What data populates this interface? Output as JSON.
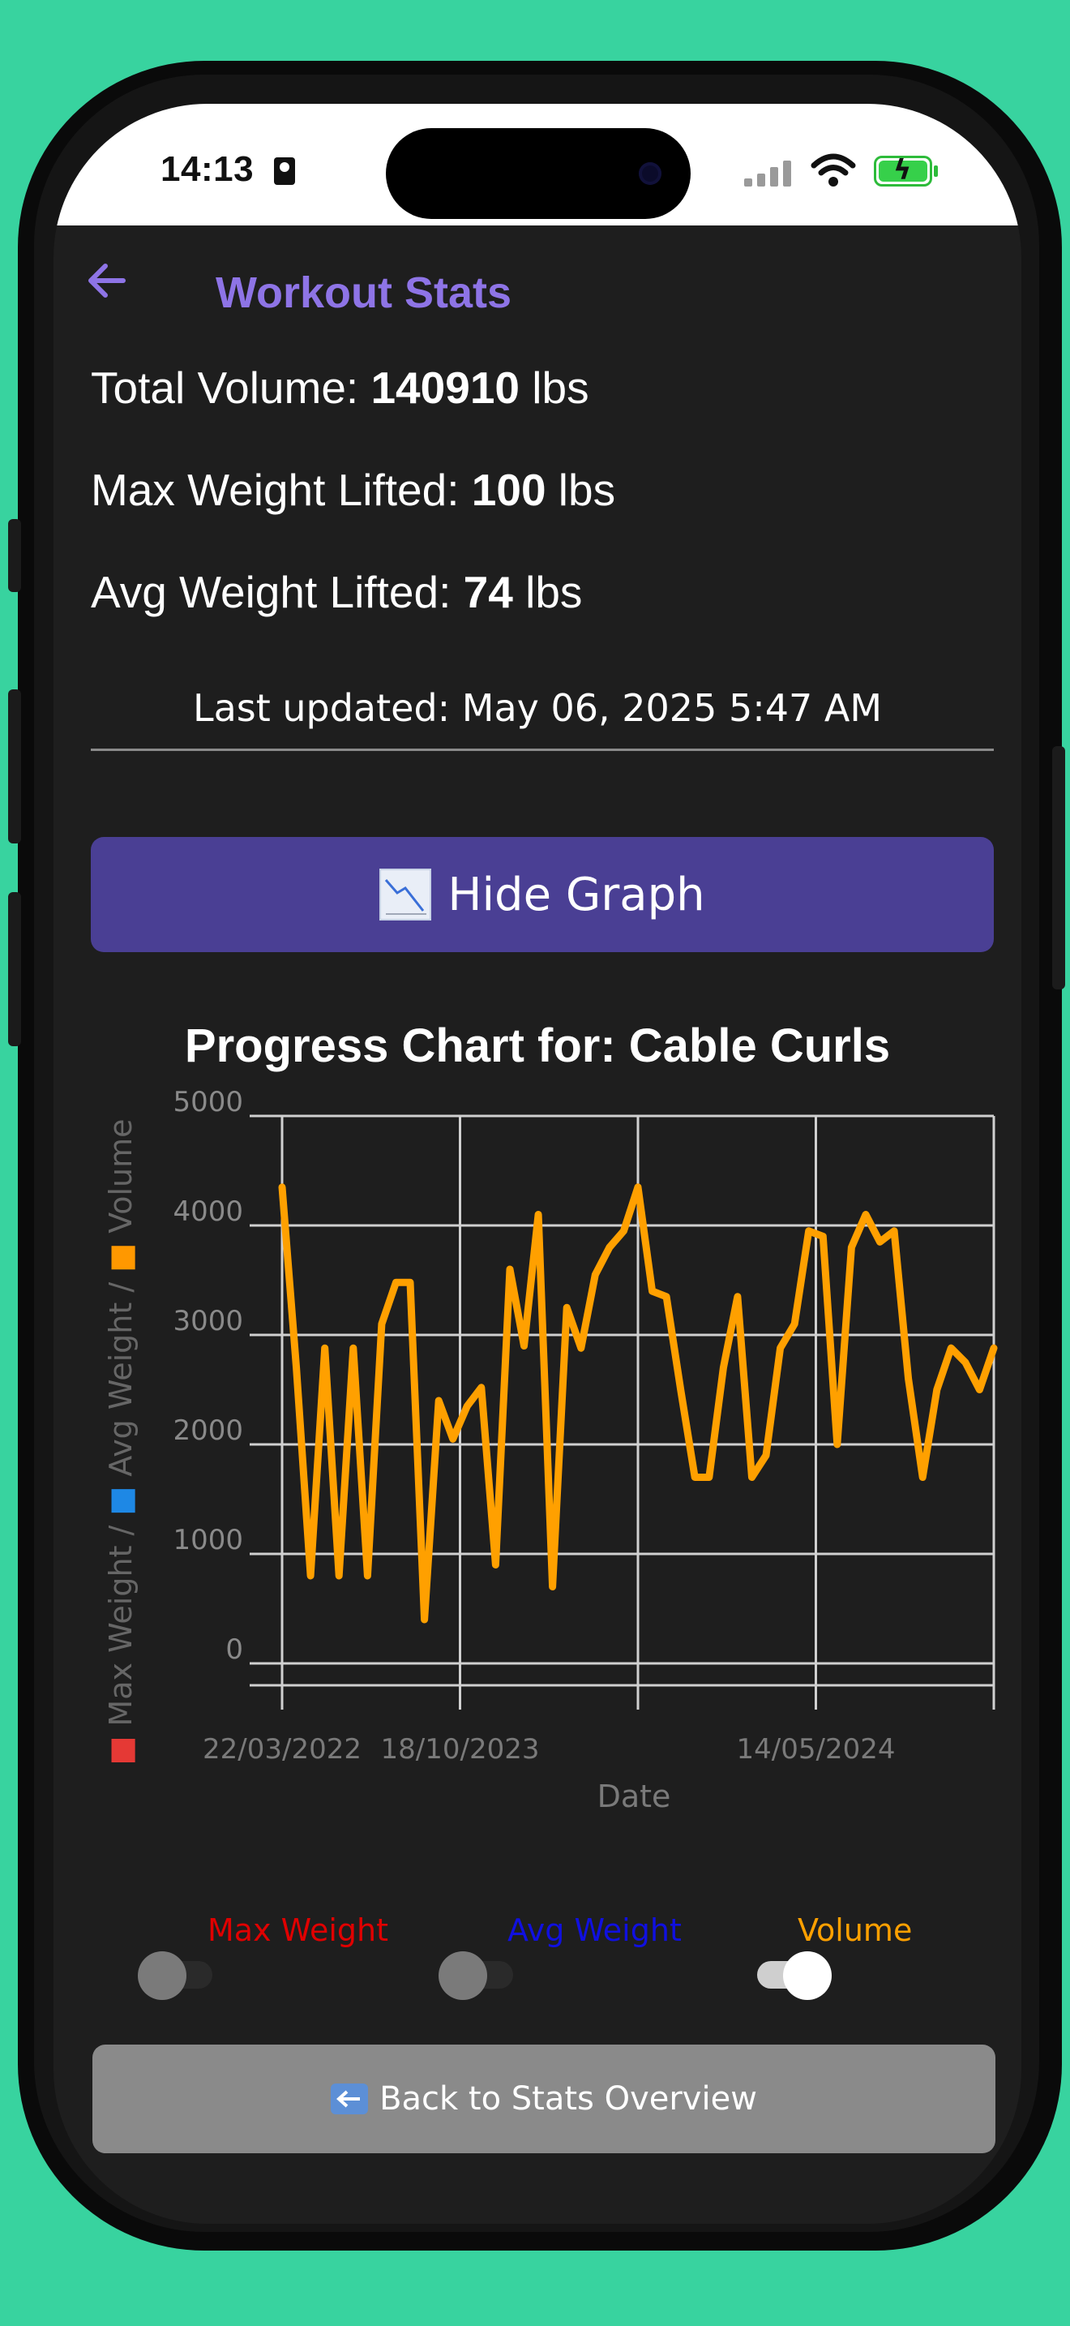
{
  "status_bar": {
    "time": "14:13"
  },
  "header": {
    "back_icon": "arrow-left-icon",
    "title": "Workout Stats"
  },
  "stats": {
    "total_volume_label": "Total Volume: ",
    "total_volume_value": "140910",
    "max_weight_label": "Max Weight Lifted: ",
    "max_weight_value": "100",
    "avg_weight_label": "Avg Weight Lifted: ",
    "avg_weight_value": "74",
    "unit": " lbs",
    "last_updated": "Last updated: May 06, 2025 5:47 AM"
  },
  "graph_button": {
    "icon": "chart-decreasing-icon",
    "label": "Hide Graph"
  },
  "chart_data": {
    "type": "line",
    "title": "Progress Chart for: Cable Curls",
    "xlabel": "Date",
    "ylabel": "Max Weight / Avg Weight / Volume",
    "ylabel_parts": [
      "Max Weight / ",
      "Avg Weight / ",
      "Volume"
    ],
    "ylabel_colors": [
      "#E53935",
      "#1E88E5",
      "#FF9800"
    ],
    "ylim": [
      -200,
      5000
    ],
    "yticks": [
      0,
      1000,
      2000,
      3000,
      4000,
      5000
    ],
    "xtick_labels": [
      "22/03/2022",
      "18/10/2023",
      "",
      "14/05/2024",
      ""
    ],
    "grid": true,
    "series": [
      {
        "name": "Volume",
        "color": "#FFA000",
        "values": [
          4350,
          2700,
          800,
          2880,
          800,
          2880,
          800,
          3100,
          3480,
          3480,
          400,
          2400,
          2050,
          2350,
          2520,
          900,
          3600,
          2900,
          4100,
          700,
          3250,
          2880,
          3550,
          3800,
          3950,
          4350,
          3400,
          3350,
          2500,
          1700,
          1700,
          2700,
          3350,
          1700,
          1900,
          2880,
          3100,
          3950,
          3900,
          2000,
          3800,
          4100,
          3850,
          3950,
          2600,
          1700,
          2500,
          2880,
          2750,
          2500,
          2880
        ]
      }
    ]
  },
  "toggles": [
    {
      "label": "Max Weight",
      "color": "#E00000",
      "on": false
    },
    {
      "label": "Avg Weight",
      "color": "#1010E0",
      "on": false
    },
    {
      "label": "Volume",
      "color": "#FFA000",
      "on": true
    }
  ],
  "back_button": {
    "icon": "back-arrow-icon",
    "label": "Back to Stats Overview"
  }
}
